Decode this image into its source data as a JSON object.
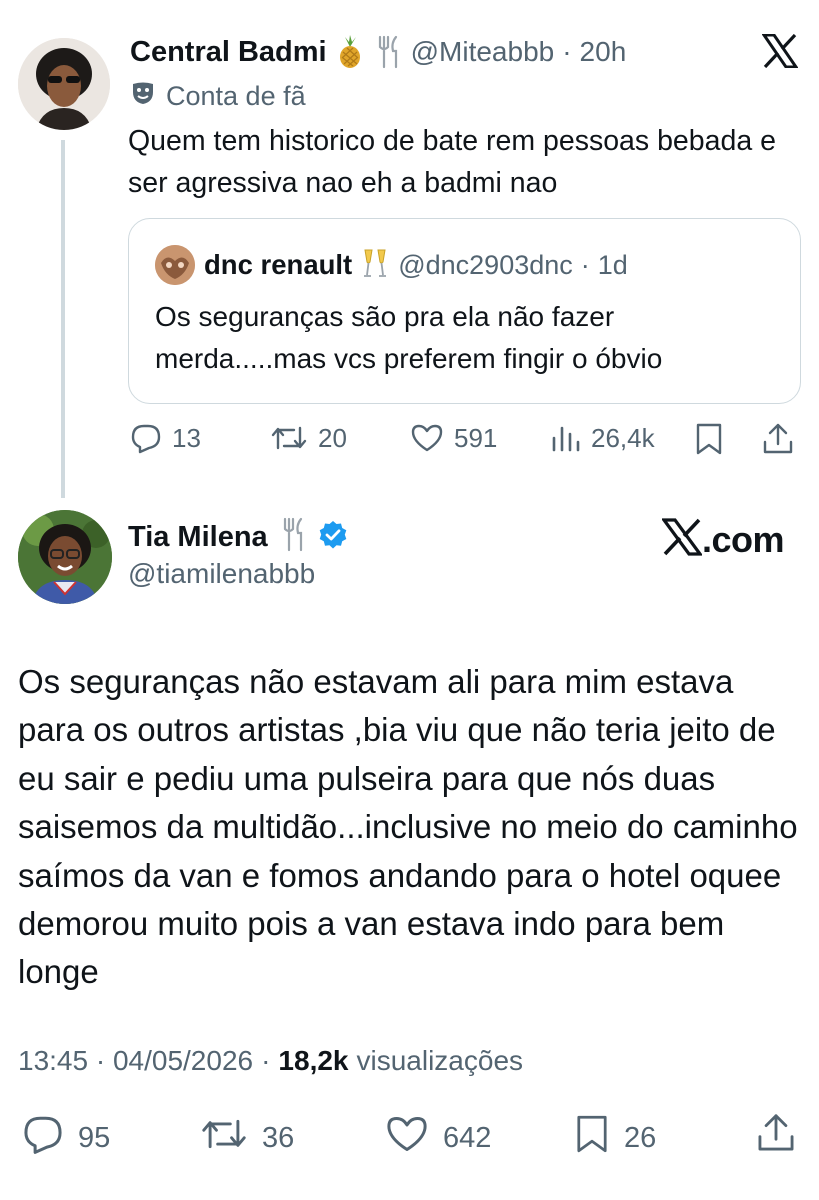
{
  "parent_tweet": {
    "author_name": "Central Badmi",
    "handle": "@Miteabbb",
    "separator": "·",
    "time": "20h",
    "label_icon": "theater-masks-icon",
    "label": "Conta de fã",
    "text": "Quem tem historico de bate rem pessoas bebada e ser agressiva nao eh a badmi nao",
    "quote": {
      "author_name": "dnc renault",
      "handle": "@dnc2903dnc",
      "separator": "·",
      "time": "1d",
      "text": "Os seguranças são pra ela não fazer merda.....mas vcs preferem fingir o óbvio"
    },
    "actions": {
      "replies": "13",
      "reposts": "20",
      "likes": "591",
      "views": "26,4k"
    }
  },
  "main_tweet": {
    "author_name": "Tia Milena",
    "handle": "@tiamilenabbb",
    "verified": true,
    "watermark": "𝕏.com",
    "watermark_text": ".com",
    "text": "Os seguranças não estavam ali para mim estava para os outros artistas ,bia viu que não teria jeito de eu sair e pediu uma pulseira para que nós duas saisemos da multidão...inclusive no meio do caminho saímos da van e fomos andando para o hotel oquee demorou muito pois a van estava indo para bem longe",
    "timestamp": "13:45 · 04/05/2026",
    "separator": "·",
    "views_count": "18,2k",
    "views_label": "visualizações",
    "actions": {
      "replies": "95",
      "reposts": "36",
      "likes": "642",
      "bookmarks": "26"
    }
  },
  "colors": {
    "text": "#0f1419",
    "secondary": "#536471",
    "border": "#cfd9de",
    "verified": "#1d9bf0"
  }
}
